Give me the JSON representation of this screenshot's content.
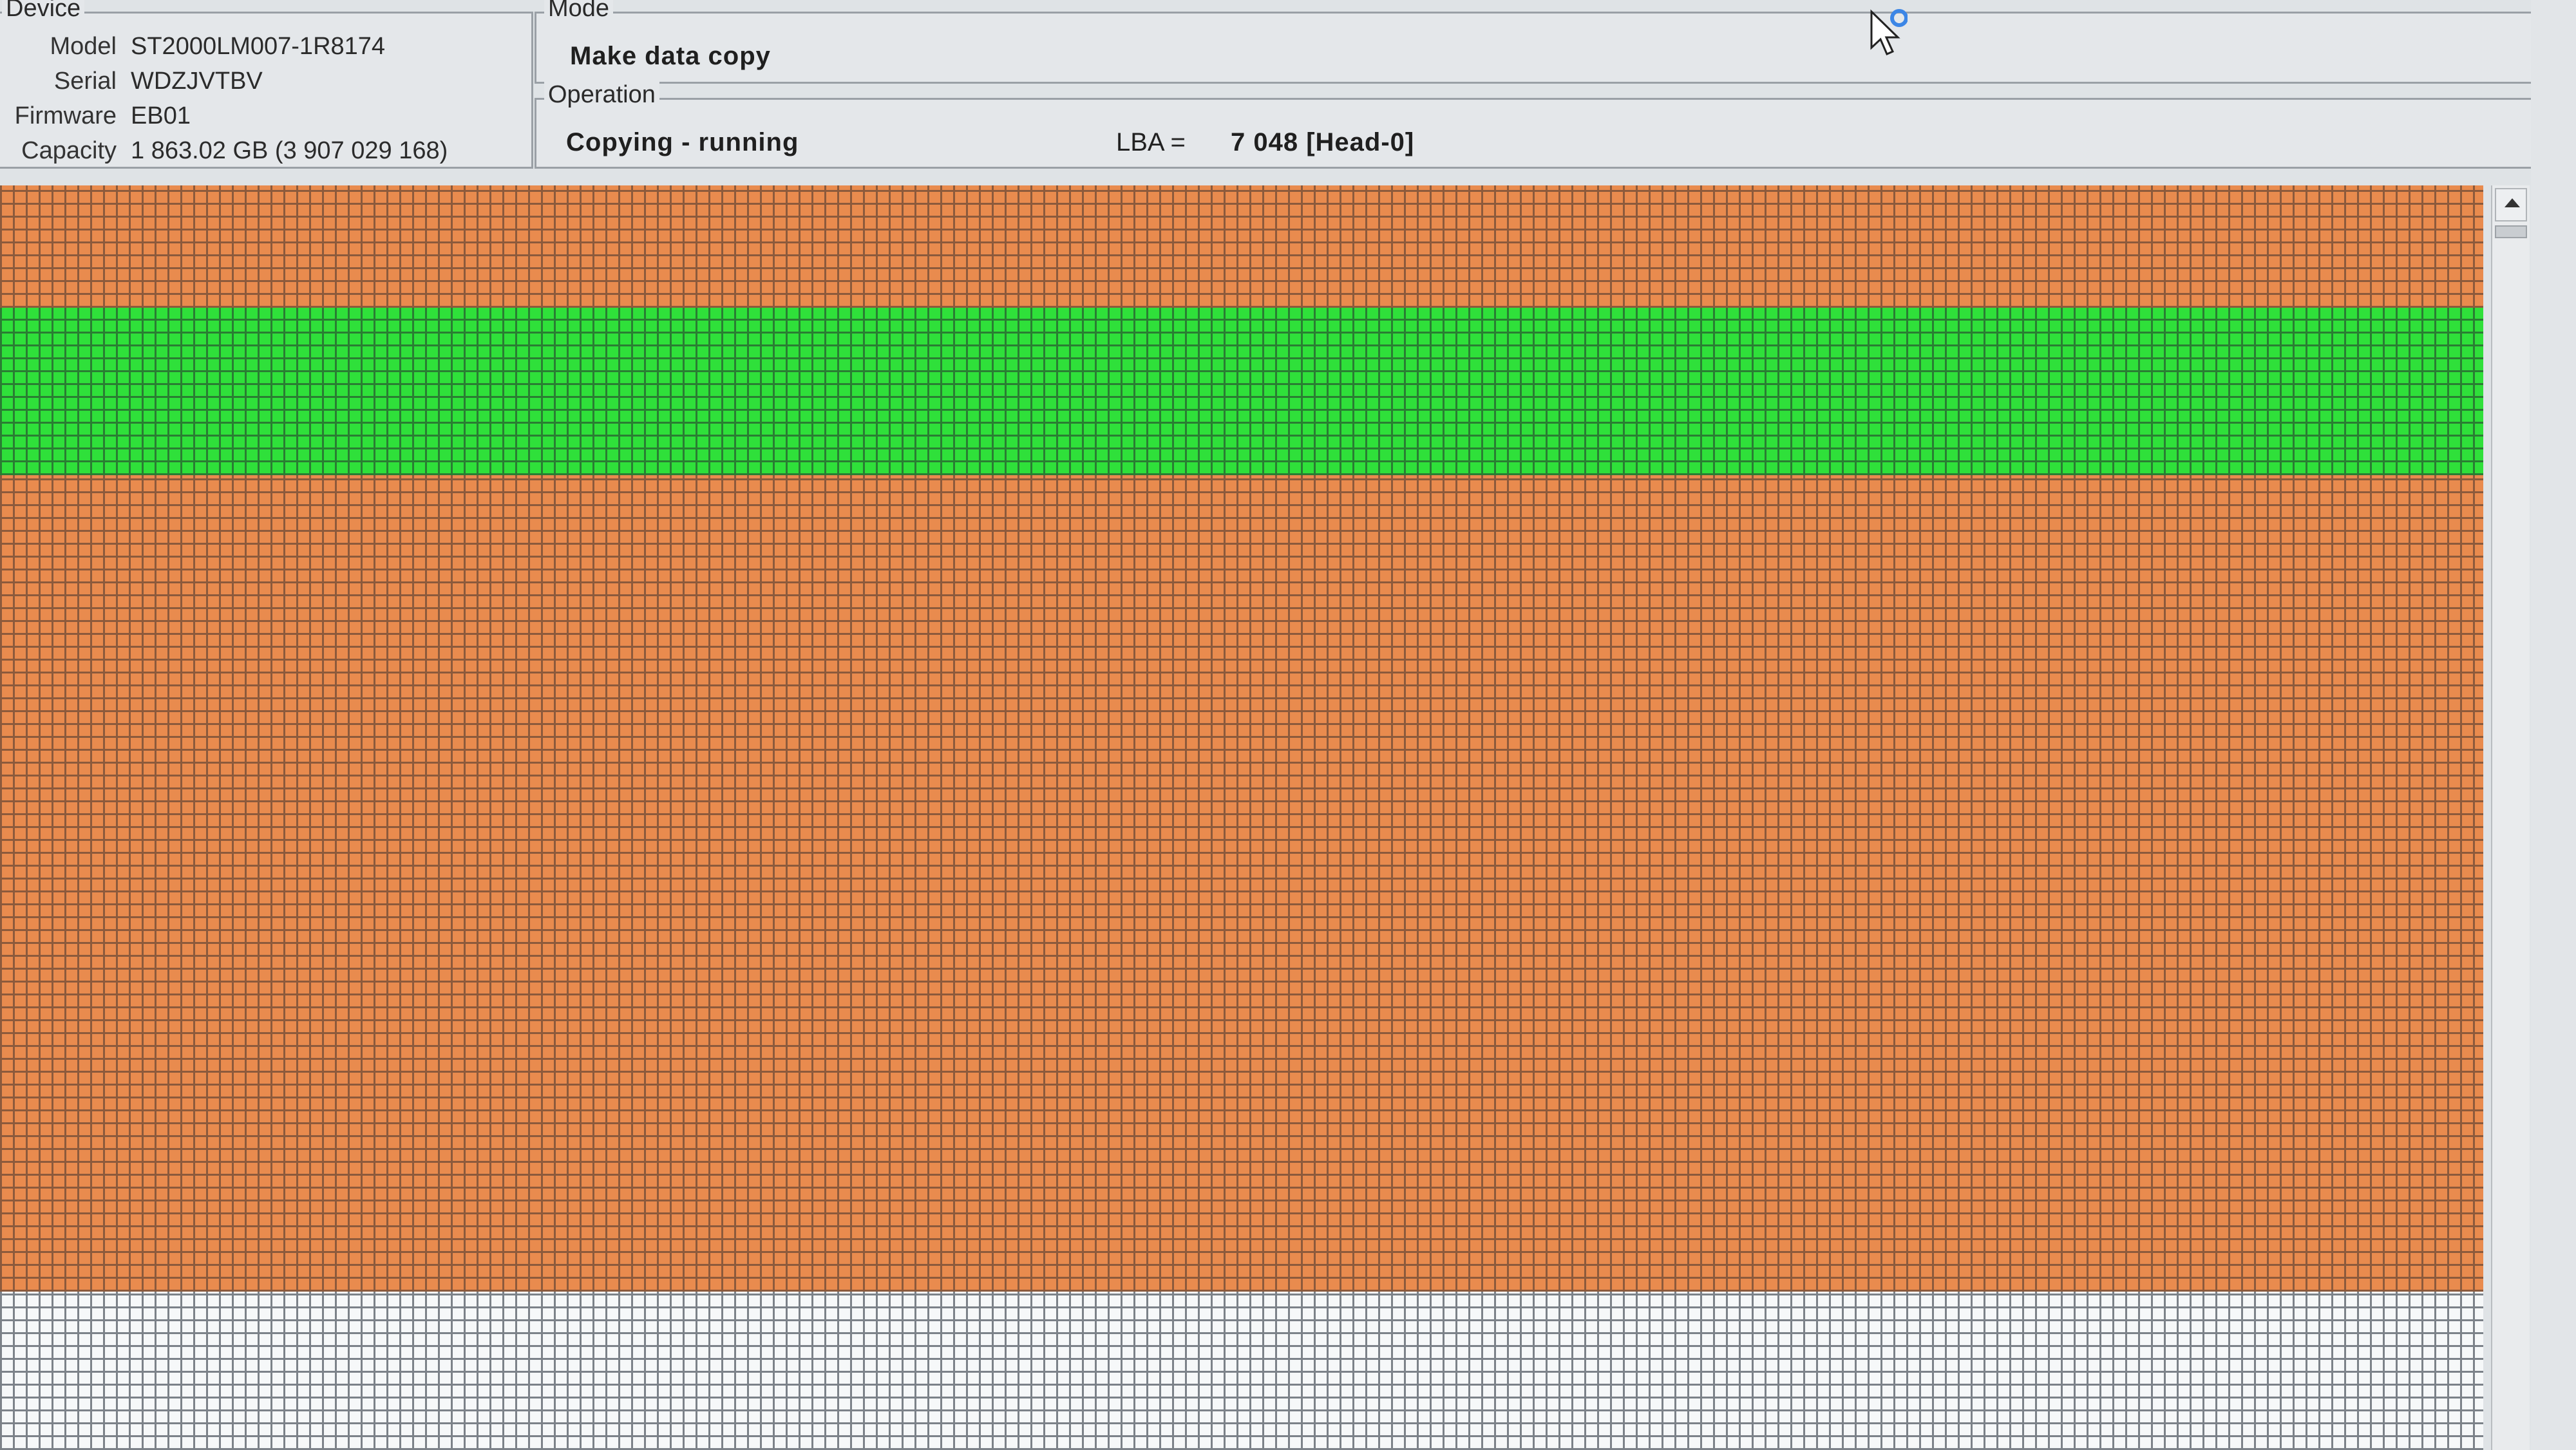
{
  "device": {
    "legend": "Device",
    "model_label": "Model",
    "model_value": "ST2000LM007-1R8174",
    "serial_label": "Serial",
    "serial_value": "WDZJVTBV",
    "firmware_label": "Firmware",
    "firmware_value": "EB01",
    "capacity_label": "Capacity",
    "capacity_value": "1 863.02 GB (3 907 029 168)"
  },
  "mode": {
    "legend": "Mode",
    "value": "Make data copy"
  },
  "operation": {
    "legend": "Operation",
    "status": "Copying - running",
    "lba_label": "LBA =",
    "lba_value": "7 048  [Head-0]"
  },
  "sector_map": {
    "colors": {
      "read_error": "#e98b4e",
      "copied_ok": "#2fe03a",
      "unprocessed": "#f6f8f9"
    }
  },
  "icons": {
    "cursor": "arrow-cursor-icon",
    "busy": "busy-spinner-icon",
    "scroll_up": "scroll-up-arrow-icon"
  }
}
